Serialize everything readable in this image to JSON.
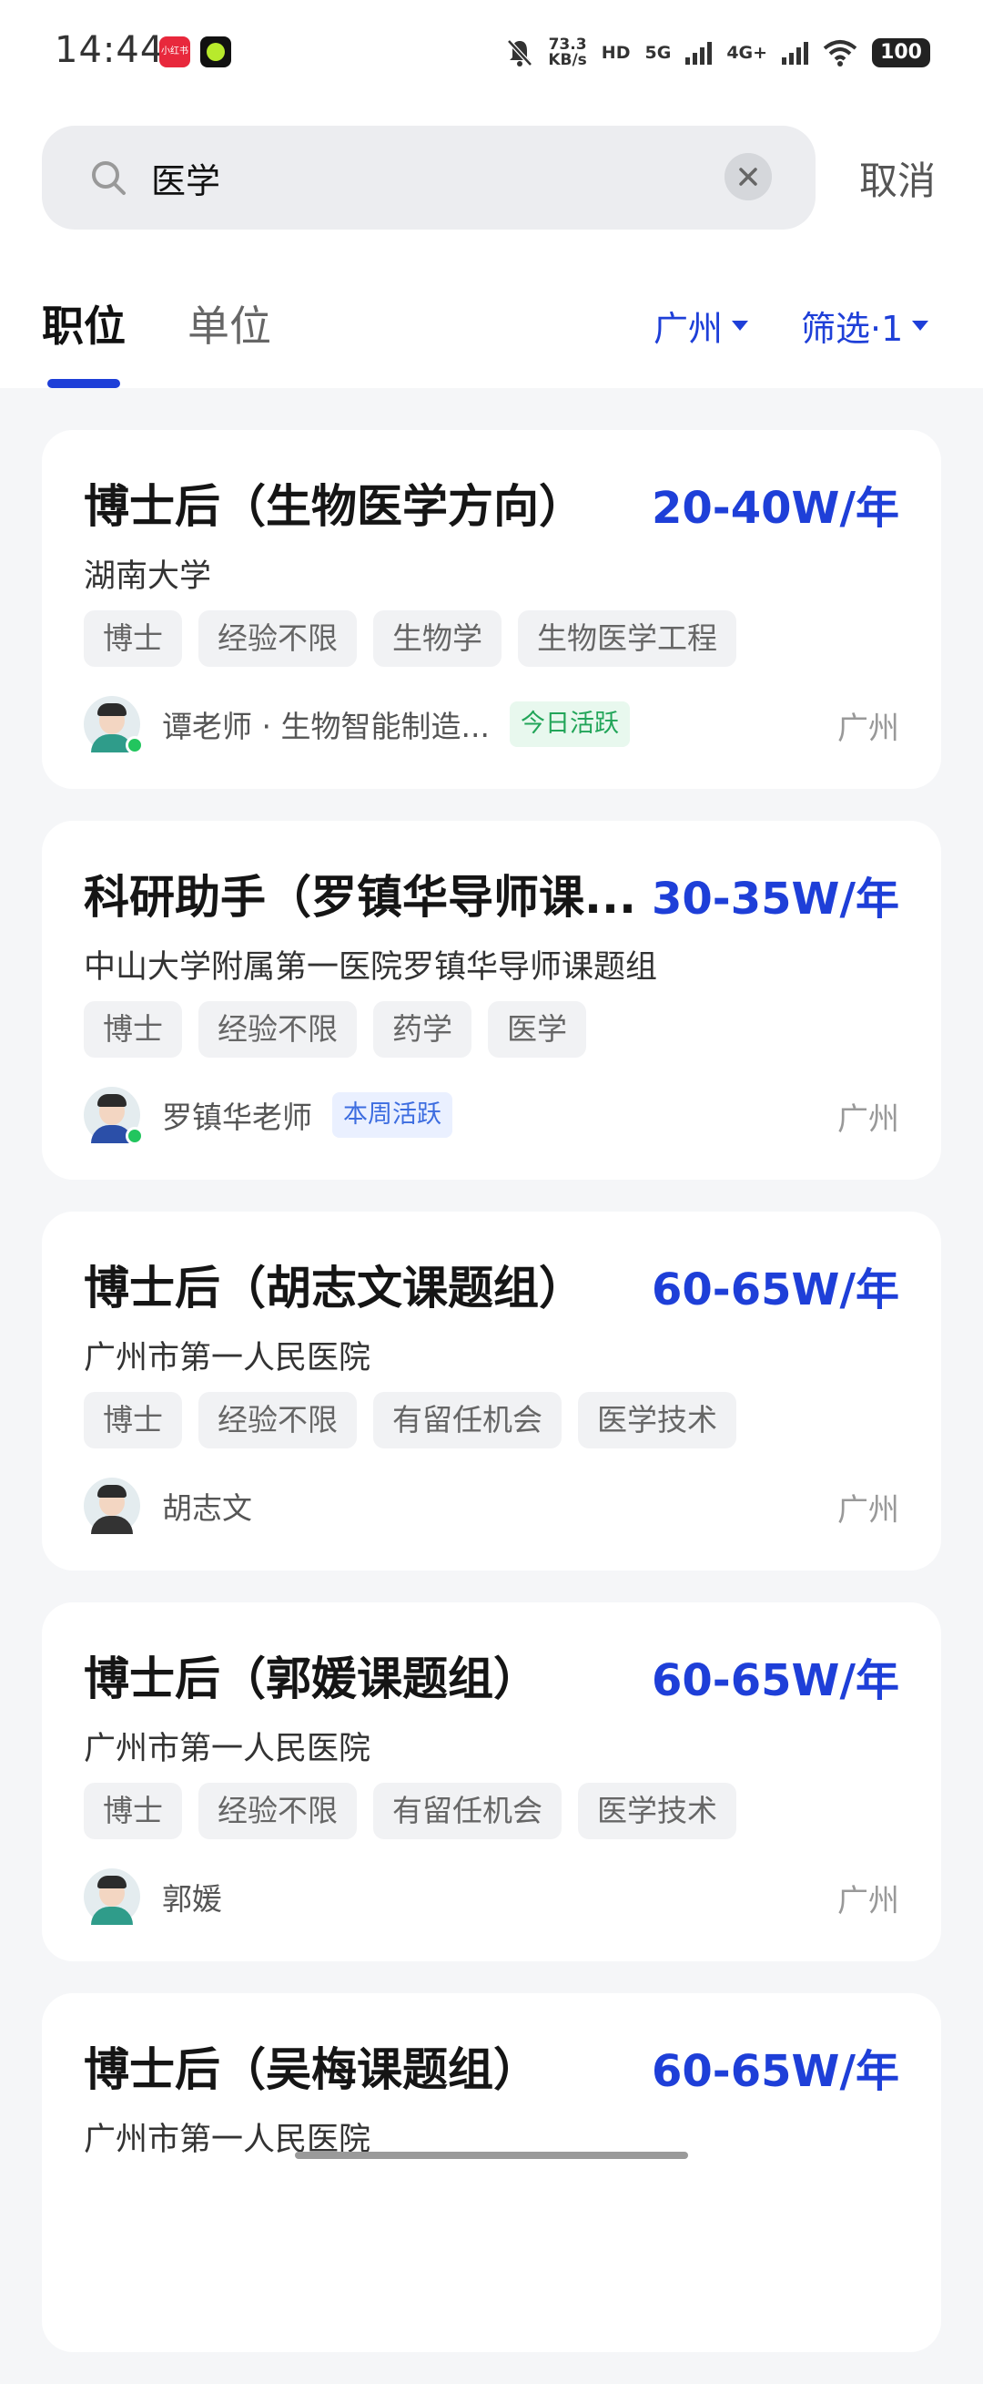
{
  "status_bar": {
    "time": "14:44",
    "app1_label": "小红书",
    "net_speed_value": "73.3",
    "net_speed_unit": "KB/s",
    "hd_label": "HD",
    "sim1": "5G",
    "sim2": "4G+",
    "battery": "100"
  },
  "search": {
    "query": "医学",
    "cancel_label": "取消"
  },
  "tabs": [
    {
      "label": "职位",
      "active": true
    },
    {
      "label": "单位",
      "active": false
    }
  ],
  "filters": {
    "city": "广州",
    "more": "筛选·1"
  },
  "jobs": [
    {
      "title": "博士后（生物医学方向）",
      "salary": "20-40W/年",
      "org": "湖南大学",
      "tags": [
        "博士",
        "经验不限",
        "生物学",
        "生物医学工程"
      ],
      "recruiter": "谭老师 · 生物智能制造...",
      "badge": "今日活跃",
      "city": "广州"
    },
    {
      "title": "科研助手（罗镇华导师课...",
      "salary": "30-35W/年",
      "org": "中山大学附属第一医院罗镇华导师课题组",
      "tags": [
        "博士",
        "经验不限",
        "药学",
        "医学"
      ],
      "recruiter": "罗镇华老师",
      "badge": "本周活跃",
      "city": "广州"
    },
    {
      "title": "博士后（胡志文课题组）",
      "salary": "60-65W/年",
      "org": "广州市第一人民医院",
      "tags": [
        "博士",
        "经验不限",
        "有留任机会",
        "医学技术"
      ],
      "recruiter": "胡志文",
      "city": "广州"
    },
    {
      "title": "博士后（郭媛课题组）",
      "salary": "60-65W/年",
      "org": "广州市第一人民医院",
      "tags": [
        "博士",
        "经验不限",
        "有留任机会",
        "医学技术"
      ],
      "recruiter": "郭媛",
      "city": "广州"
    },
    {
      "title": "博士后（吴梅课题组）",
      "salary": "60-65W/年",
      "org": "广州市第一人民医院"
    }
  ],
  "colors": {
    "accent": "#1e3fd8",
    "active_green": "#22a559",
    "active_blue": "#3d6de0"
  }
}
